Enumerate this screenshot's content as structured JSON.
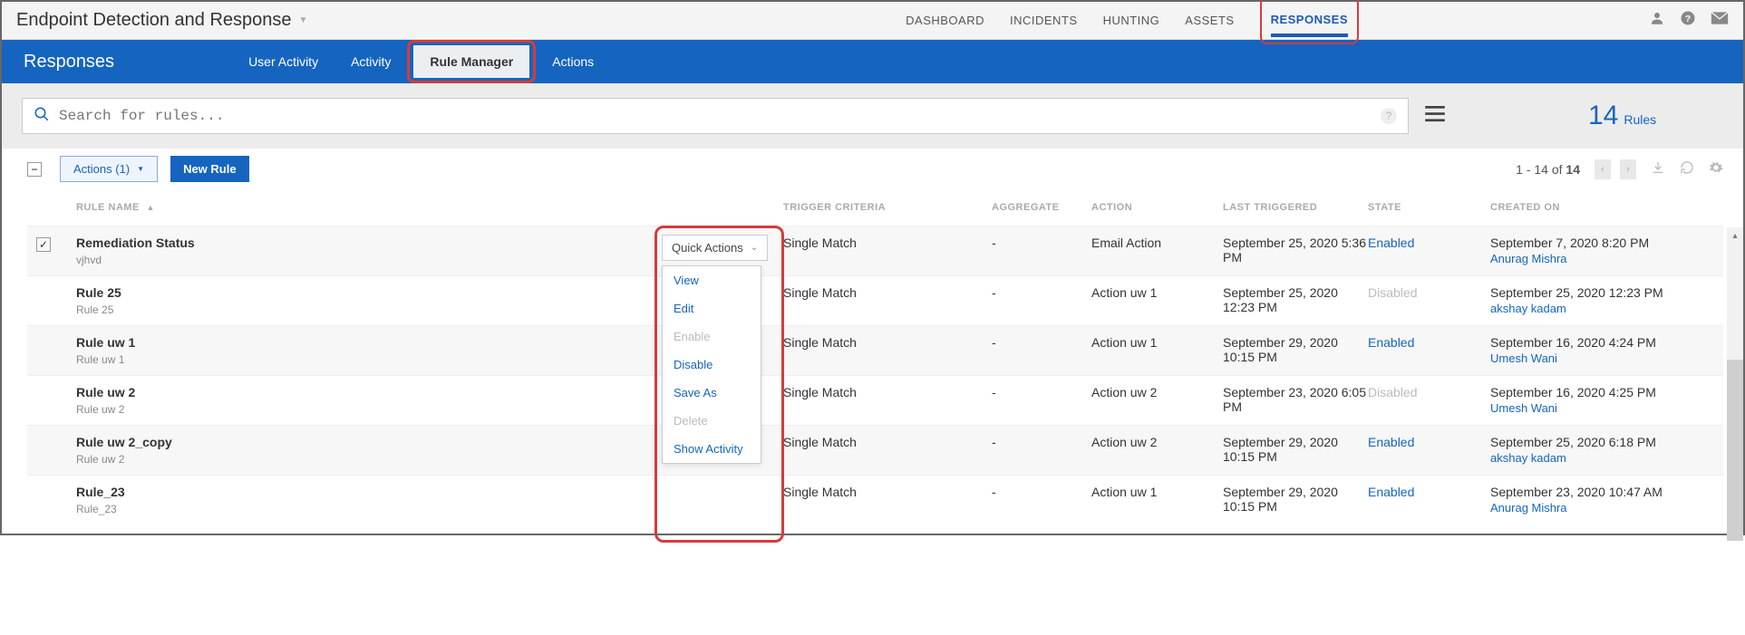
{
  "topbar": {
    "title": "Endpoint Detection and Response",
    "nav": [
      "DASHBOARD",
      "INCIDENTS",
      "HUNTING",
      "ASSETS",
      "RESPONSES"
    ],
    "active_nav": "RESPONSES"
  },
  "bluebar": {
    "title": "Responses",
    "tabs": [
      "User Activity",
      "Activity",
      "Rule Manager",
      "Actions"
    ],
    "active_tab": "Rule Manager"
  },
  "search": {
    "placeholder": "Search for rules...",
    "rules_count": "14",
    "rules_label": "Rules"
  },
  "toolbar": {
    "actions_label": "Actions (1)",
    "new_rule_label": "New Rule",
    "range_text": "1 - 14 of",
    "range_total": "14"
  },
  "table": {
    "headers": {
      "name": "RULE NAME",
      "trigger": "TRIGGER CRITERIA",
      "aggregate": "AGGREGATE",
      "action": "ACTION",
      "last": "LAST TRIGGERED",
      "state": "STATE",
      "created": "CREATED ON"
    },
    "rows": [
      {
        "checked": true,
        "name": "Remediation Status",
        "sub": "vjhvd",
        "trigger": "Single Match",
        "aggregate": "-",
        "action": "Email Action",
        "last": "September 25, 2020 5:36 PM",
        "state": "Enabled",
        "created": "September 7, 2020 8:20 PM",
        "by": "Anurag Mishra"
      },
      {
        "checked": false,
        "name": "Rule 25",
        "sub": "Rule 25",
        "trigger": "Single Match",
        "aggregate": "-",
        "action": "Action uw 1",
        "last": "September 25, 2020 12:23 PM",
        "state": "Disabled",
        "created": "September 25, 2020 12:23 PM",
        "by": "akshay kadam"
      },
      {
        "checked": false,
        "name": "Rule uw 1",
        "sub": "Rule uw 1",
        "trigger": "Single Match",
        "aggregate": "-",
        "action": "Action uw 1",
        "last": "September 29, 2020 10:15 PM",
        "state": "Enabled",
        "created": "September 16, 2020 4:24 PM",
        "by": "Umesh Wani"
      },
      {
        "checked": false,
        "name": "Rule uw 2",
        "sub": "Rule uw 2",
        "trigger": "Single Match",
        "aggregate": "-",
        "action": "Action uw 2",
        "last": "September 23, 2020 6:05 PM",
        "state": "Disabled",
        "created": "September 16, 2020 4:25 PM",
        "by": "Umesh Wani"
      },
      {
        "checked": false,
        "name": "Rule uw 2_copy",
        "sub": "Rule uw 2",
        "trigger": "Single Match",
        "aggregate": "-",
        "action": "Action uw 2",
        "last": "September 29, 2020 10:15 PM",
        "state": "Enabled",
        "created": "September 25, 2020 6:18 PM",
        "by": "akshay kadam"
      },
      {
        "checked": false,
        "name": "Rule_23",
        "sub": "Rule_23",
        "trigger": "Single Match",
        "aggregate": "-",
        "action": "Action uw 1",
        "last": "September 29, 2020 10:15 PM",
        "state": "Enabled",
        "created": "September 23, 2020 10:47 AM",
        "by": "Anurag Mishra"
      }
    ]
  },
  "quick_actions": {
    "button_label": "Quick Actions",
    "items": [
      {
        "label": "View",
        "disabled": false
      },
      {
        "label": "Edit",
        "disabled": false
      },
      {
        "label": "Enable",
        "disabled": true
      },
      {
        "label": "Disable",
        "disabled": false
      },
      {
        "label": "Save As",
        "disabled": false
      },
      {
        "label": "Delete",
        "disabled": true
      },
      {
        "label": "Show Activity",
        "disabled": false
      }
    ]
  }
}
